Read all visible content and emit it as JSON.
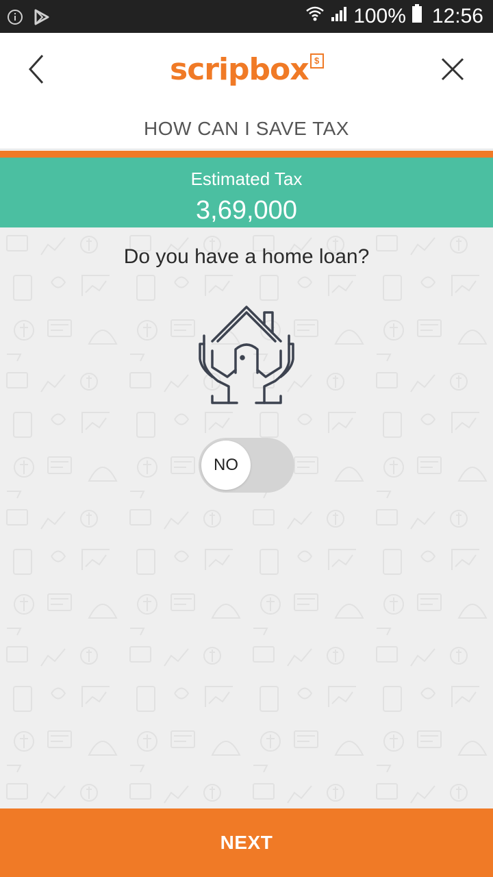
{
  "status_bar": {
    "battery_percent": "100%",
    "time": "12:56",
    "icons": [
      "info-icon",
      "play-store-icon",
      "wifi-icon",
      "signal-icon",
      "battery-icon"
    ]
  },
  "header": {
    "logo_text": "scripbox",
    "logo_badge": "$",
    "title": "HOW CAN I SAVE TAX",
    "icons": [
      "chevron-left-icon",
      "close-icon"
    ]
  },
  "tax": {
    "label": "Estimated Tax",
    "value": "3,69,000"
  },
  "question": {
    "text": "Do you have a home loan?",
    "icon": "home-loan-icon"
  },
  "toggle": {
    "label": "NO",
    "checked": false
  },
  "footer": {
    "next_label": "NEXT"
  },
  "colors": {
    "accent_orange": "#f07a26",
    "banner_green": "#4bbfa1",
    "status_bar": "#222222",
    "content_bg": "#efefef"
  }
}
